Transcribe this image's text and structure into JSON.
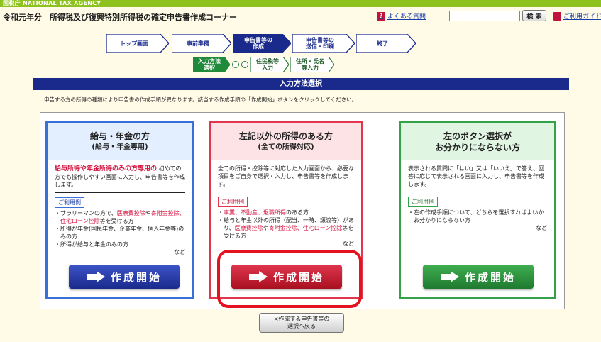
{
  "agency": "国税庁 NATIONAL TAX AGENCY",
  "header": {
    "title": "令和元年分　所得税及び復興特別所得税の確定申告書作成コーナー",
    "faq": "よくある質問",
    "search_placeholder": "",
    "search_button": "検 索",
    "guide": "ご利用ガイド"
  },
  "steps": [
    {
      "label": "トップ画面",
      "state": "done"
    },
    {
      "label": "事前準備",
      "state": "done"
    },
    {
      "label": "申告書等の\n作成",
      "state": "current"
    },
    {
      "label": "申告書等の\n送信・印刷",
      "state": "todo"
    },
    {
      "label": "終了",
      "state": "todo"
    }
  ],
  "substeps": [
    {
      "label": "入力方法\n選択",
      "state": "current"
    },
    {
      "label": "住民税等\n入力",
      "state": "todo"
    },
    {
      "label": "住所・氏名\n等入力",
      "state": "todo"
    }
  ],
  "section_title": "入力方法選択",
  "instruction": "申告する方の所得の種類により申告書の作成手順が異なります。該当する作成手順の「作成開始」ボタンをクリックしてください。",
  "cards": {
    "salary": {
      "title": "給与・年金の方",
      "subtitle": "(給与・年金専用)",
      "lead_red": "給与所得や年金所得のみの方専用の",
      "lead_rest": "初めての方でも操作しやすい画面に入力し、申告書等を作成します。",
      "usage_label": "ご利用例",
      "ex1_a": "・サラリーマンの方で、",
      "ex1_b": "医療費控除",
      "ex1_c": "や",
      "ex1_d": "寄附金控除、住宅ローン控除",
      "ex1_e": "等を受ける方",
      "ex2": "・所得が年金(国民年金、企業年金、個人年金等)のみの方",
      "ex3": "・所得が給与と年金のみの方",
      "etc": "など",
      "button": "作成開始",
      "color": "#3a6fd8",
      "head_bg": "#e3efff"
    },
    "other": {
      "title": "左記以外の所得のある方",
      "subtitle": "(全ての所得対応)",
      "lead": "全ての所得・控除等に対応した入力画面から、必要な項目をご自身で選択・入力し、申告書等を作成します。",
      "usage_label": "ご利用例",
      "ex1_a": "・",
      "ex1_b": "事業、不動産、退職所得",
      "ex1_c": "のある方",
      "ex2_a": "・給与と年金以外の所得（配当、一時、譲渡等）があり、",
      "ex2_b": "医療費控除",
      "ex2_c": "や",
      "ex2_d": "寄附金控除、住宅ローン控除",
      "ex2_e": "等を受ける方",
      "etc": "など",
      "button": "作成開始",
      "color": "#e0364e",
      "head_bg": "#fde3e6"
    },
    "unsure": {
      "title": "左のボタン選択が",
      "title2": "お分かりにならない方",
      "lead": "表示される質問に「はい」又は「いいえ」で答え、回答に応じて表示される画面に入力し、申告書等を作成します。",
      "usage_label": "ご利用例",
      "ex1": "・左の作成手順について、どちらを選択すればよいかお分かりにならない方",
      "etc": "など",
      "button": "作成開始",
      "color": "#35a24a",
      "head_bg": "#e1f5e3"
    }
  },
  "back_button": "<作成する申告書等の\n選択へ戻る",
  "colors": {
    "nav_blue": "#1a2a8c",
    "topbar_green": "#8ec21f",
    "highlight_red": "#e5121f"
  }
}
